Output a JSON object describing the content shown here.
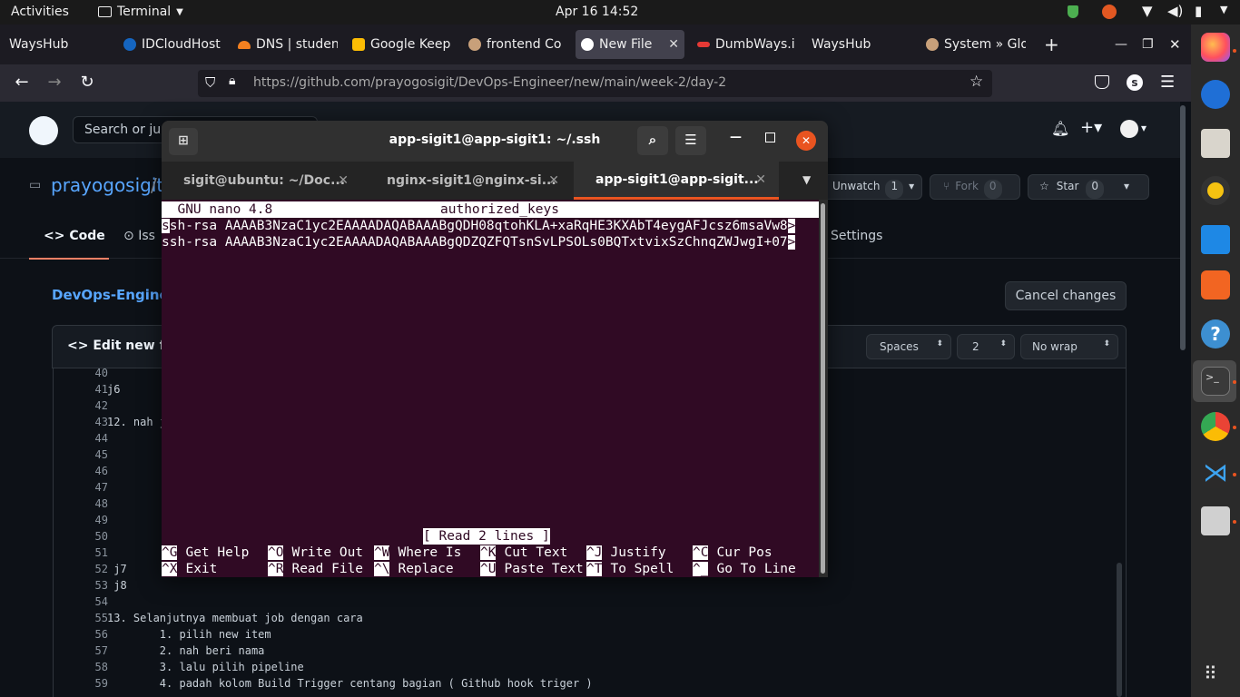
{
  "topbar": {
    "activities": "Activities",
    "app": "Terminal",
    "clock": "Apr 16  14:52"
  },
  "browser": {
    "tabs": [
      {
        "label": "WaysHub",
        "color": "#1c1b22"
      },
      {
        "label": "IDCloudHost",
        "color": "#1565c0"
      },
      {
        "label": "DNS | studen",
        "color": "#f38020"
      },
      {
        "label": "Google Keep",
        "color": "#fbbc04"
      },
      {
        "label": "frontend Co",
        "color": "#c8a07a"
      },
      {
        "label": "New File",
        "color": "#ffffff"
      },
      {
        "label": "DumbWays.i",
        "color": "#e53935"
      },
      {
        "label": "WaysHub",
        "color": "#1c1b22"
      },
      {
        "label": "System » Glo",
        "color": "#c8a07a"
      }
    ],
    "active_close": "✕",
    "new_tab": "+",
    "url": "https://github.com/prayogosigit/DevOps-Engineer/new/main/week-2/day-2",
    "url_host": "github.com",
    "profile_letter": "s"
  },
  "github": {
    "search_placeholder": "Search or jum",
    "owner": "prayogosigit",
    "sep": "/",
    "watch_label": "Unwatch",
    "watch_count": "1",
    "fork_label": "Fork",
    "fork_count": "0",
    "star_label": "Star",
    "star_count": "0",
    "nav": {
      "code": "Code",
      "issues": "Iss",
      "settings": "Settings"
    },
    "breadcrumb": "DevOps-Engine",
    "cancel": "Cancel changes",
    "edit_tab": "Edit new file",
    "indent_mode": "Spaces",
    "indent_size": "2",
    "wrap_mode": "No wrap",
    "lines": [
      {
        "n": "40",
        "t": ""
      },
      {
        "n": "41",
        "t": "j6"
      },
      {
        "n": "42",
        "t": ""
      },
      {
        "n": "43",
        "t": "12. nah j"
      },
      {
        "n": "44",
        "t": ""
      },
      {
        "n": "45",
        "t": ""
      },
      {
        "n": "46",
        "t": ""
      },
      {
        "n": "47",
        "t": ""
      },
      {
        "n": "48",
        "t": ""
      },
      {
        "n": "49",
        "t": ""
      },
      {
        "n": "50",
        "t": ""
      },
      {
        "n": "51",
        "t": ""
      },
      {
        "n": "52",
        "t": " j7"
      },
      {
        "n": "53",
        "t": " j8"
      },
      {
        "n": "54",
        "t": ""
      },
      {
        "n": "55",
        "t": "13. Selanjutnya membuat job dengan cara"
      },
      {
        "n": "56",
        "t": "        1. pilih new item"
      },
      {
        "n": "57",
        "t": "        2. nah beri nama"
      },
      {
        "n": "58",
        "t": "        3. lalu pilih pipeline"
      },
      {
        "n": "59",
        "t": "        4. padah kolom Build Trigger centang bagian ( Github hook triger )"
      }
    ]
  },
  "terminal": {
    "title": "app-sigit1@app-sigit1: ~/.ssh",
    "tabs": [
      "sigit@ubuntu: ~/Doc...",
      "nginx-sigit1@nginx-si...",
      "app-sigit1@app-sigit..."
    ],
    "nano_header_left": "  GNU nano 4.8",
    "nano_header_file": "authorized_keys",
    "line1": "sh-rsa AAAAB3NzaC1yc2EAAAADAQABAAABgQDH08qtohKLA+xaRqHE3KXAbT4eygAFJcsz6msaVw8",
    "line1_cursor": "s",
    "line2": "ssh-rsa AAAAB3NzaC1yc2EAAAADAQABAAABgQDZQZFQTsnSvLPSOLs0BQTxtvixSzChnqZWJwgI+07",
    "overflow": ">",
    "status": "[ Read 2 lines ]",
    "shortcuts": [
      [
        {
          "k": "^G",
          "l": "Get Help"
        },
        {
          "k": "^O",
          "l": "Write Out"
        },
        {
          "k": "^W",
          "l": "Where Is"
        },
        {
          "k": "^K",
          "l": "Cut Text"
        },
        {
          "k": "^J",
          "l": "Justify"
        },
        {
          "k": "^C",
          "l": "Cur Pos"
        }
      ],
      [
        {
          "k": "^X",
          "l": "Exit"
        },
        {
          "k": "^R",
          "l": "Read File"
        },
        {
          "k": "^\\",
          "l": "Replace"
        },
        {
          "k": "^U",
          "l": "Paste Text"
        },
        {
          "k": "^T",
          "l": "To Spell"
        },
        {
          "k": "^_",
          "l": "Go To Line"
        }
      ]
    ]
  }
}
